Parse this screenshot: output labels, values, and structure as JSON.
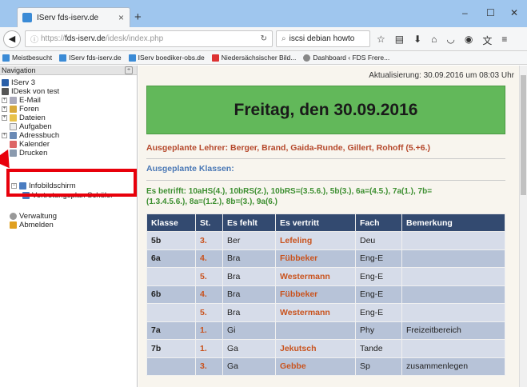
{
  "browser": {
    "tab_title": "IServ fds-iserv.de",
    "tab_close": "×",
    "new_tab": "+",
    "win_min": "–",
    "win_max": "☐",
    "win_close": "✕",
    "url_prefix": "https://",
    "url_domain": "fds-iserv.de",
    "url_path": "/idesk/index.php",
    "search_text": "iscsi debian howto",
    "bookmarks": [
      "Meistbesucht",
      "IServ fds-iserv.de",
      "IServ boediker-obs.de",
      "Niedersächsischer Bild...",
      "Dashboard ‹ FDS Frere..."
    ]
  },
  "sidebar": {
    "title": "Navigation",
    "items": [
      {
        "label": "IServ 3"
      },
      {
        "label": "IDesk von test"
      },
      {
        "label": "E-Mail"
      },
      {
        "label": "Foren"
      },
      {
        "label": "Dateien"
      },
      {
        "label": "Aufgaben"
      },
      {
        "label": "Adressbuch"
      },
      {
        "label": "Kalender"
      },
      {
        "label": "Drucken"
      },
      {
        "label": "Infobildschirm"
      },
      {
        "label": "Vertretungsplan Schüler"
      },
      {
        "label": "Verwaltung"
      },
      {
        "label": "Abmelden"
      }
    ]
  },
  "page": {
    "update_text": "Aktualisierung: 30.09.2016 um 08:03 Uhr",
    "heading": "Freitag, den 30.09.2016",
    "lehrer": "Ausgeplante Lehrer: Berger, Brand, Gaida-Runde, Gillert, Rohoff (5.+6.)",
    "klassen": "Ausgeplante Klassen:",
    "betrifft": "Es betrifft: 10aHS(4.), 10bRS(2.), 10bRS=(3.5.6.), 5b(3.), 6a=(4.5.), 7a(1.), 7b=(1.3.4.5.6.), 8a=(1.2.), 8b=(3.), 9a(6.)"
  },
  "table": {
    "headers": [
      "Klasse",
      "St.",
      "Es fehlt",
      "Es vertritt",
      "Fach",
      "Bemerkung"
    ],
    "rows": [
      [
        "5b",
        "3.",
        "Ber",
        "Lefeling",
        "Deu",
        ""
      ],
      [
        "6a",
        "4.",
        "Bra",
        "Fübbeker",
        "Eng-E",
        ""
      ],
      [
        "",
        "5.",
        "Bra",
        "Westermann",
        "Eng-E",
        ""
      ],
      [
        "6b",
        "4.",
        "Bra",
        "Fübbeker",
        "Eng-E",
        ""
      ],
      [
        "",
        "5.",
        "Bra",
        "Westermann",
        "Eng-E",
        ""
      ],
      [
        "7a",
        "1.",
        "Gi",
        "",
        "Phy",
        "Freizeitbereich"
      ],
      [
        "7b",
        "1.",
        "Ga",
        "Jekutsch",
        "Tande",
        ""
      ],
      [
        "",
        "3.",
        "Ga",
        "Gebbe",
        "Sp",
        "zusammenlegen"
      ]
    ]
  }
}
